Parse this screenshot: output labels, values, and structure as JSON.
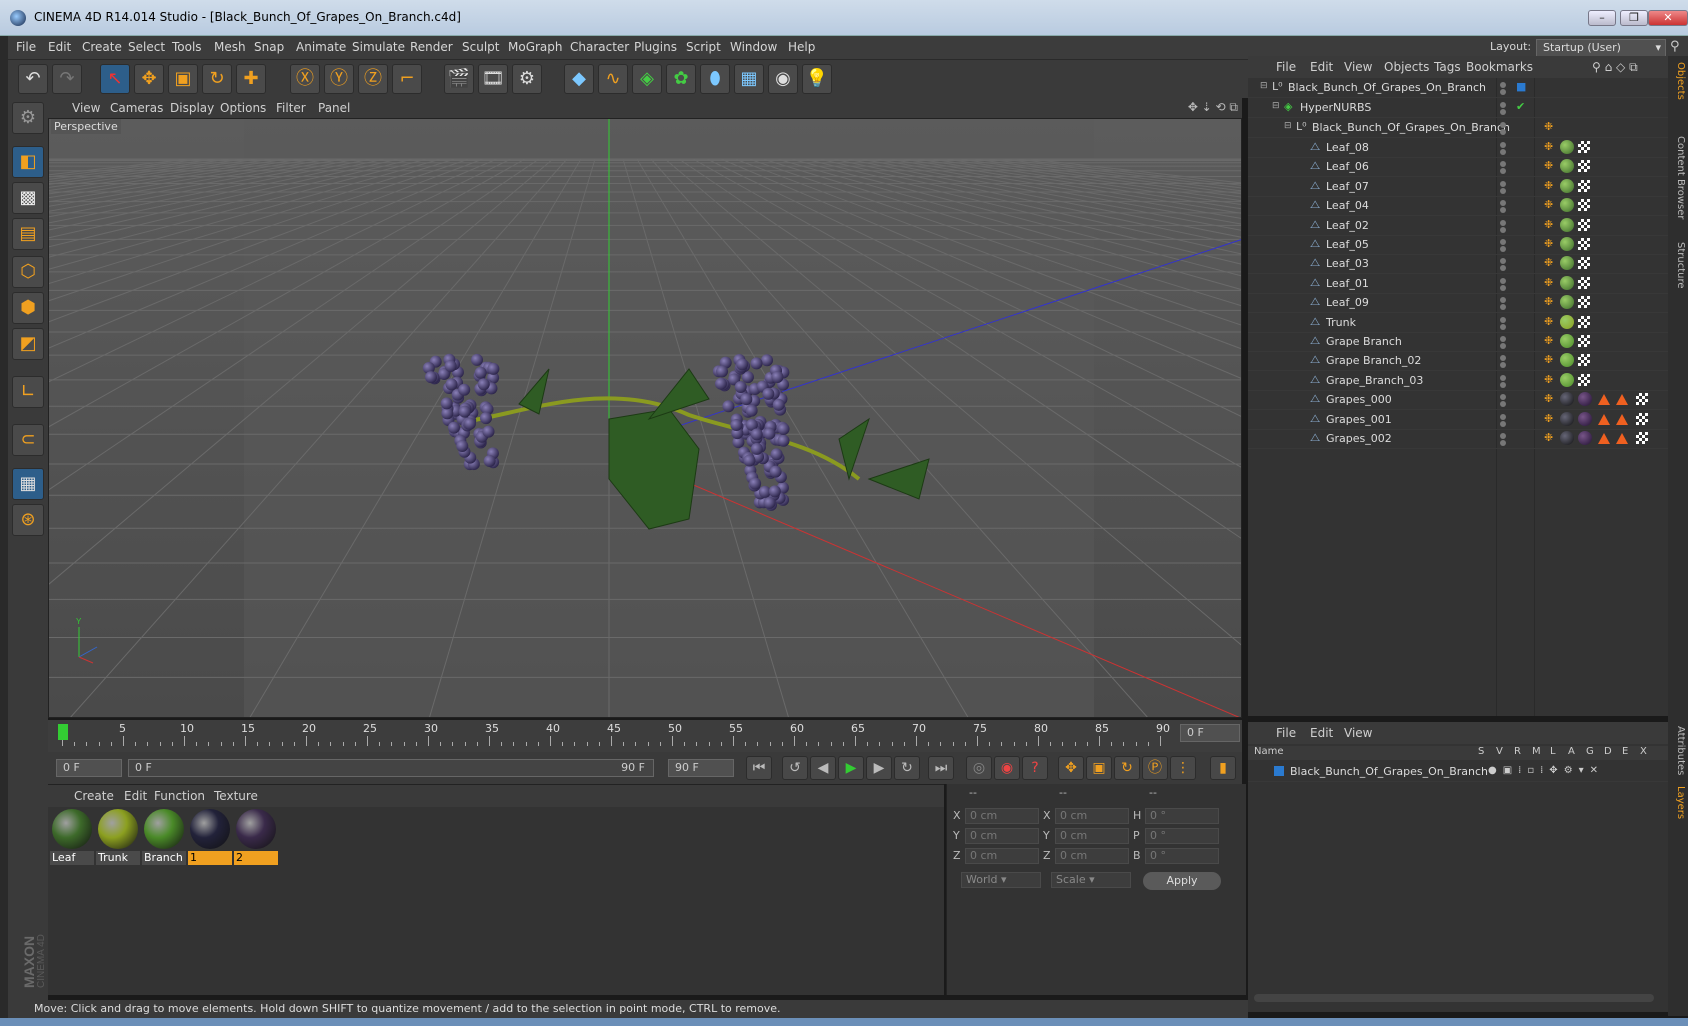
{
  "window": {
    "title": "CINEMA 4D R14.014 Studio - [Black_Bunch_Of_Grapes_On_Branch.c4d]"
  },
  "menubar": {
    "items": [
      "File",
      "Edit",
      "Create",
      "Select",
      "Tools",
      "Mesh",
      "Snap",
      "Animate",
      "Simulate",
      "Render",
      "Sculpt",
      "MoGraph",
      "Character",
      "Plugins",
      "Script",
      "Window",
      "Help"
    ],
    "layout_label": "Layout:",
    "layout_value": "Startup (User)"
  },
  "viewport": {
    "menu": [
      "View",
      "Cameras",
      "Display",
      "Options",
      "Filter",
      "Panel"
    ],
    "label": "Perspective"
  },
  "timeline": {
    "ticks": [
      "0",
      "5",
      "10",
      "15",
      "20",
      "25",
      "30",
      "35",
      "40",
      "45",
      "50",
      "55",
      "60",
      "65",
      "70",
      "75",
      "80",
      "85",
      "90"
    ],
    "current_frame": "0 F",
    "start_field": "0 F",
    "range_start": "0 F",
    "range_end": "90 F",
    "end_field": "90 F"
  },
  "materials": {
    "menu": [
      "Create",
      "Edit",
      "Function",
      "Texture"
    ],
    "items": [
      {
        "label": "Leaf",
        "color": "#3d6a2a",
        "highlight": false
      },
      {
        "label": "Trunk",
        "color": "#8ca020",
        "highlight": false
      },
      {
        "label": "Branch",
        "color": "#4a8a28",
        "highlight": false
      },
      {
        "label": "1",
        "color": "#22223a",
        "highlight": true
      },
      {
        "label": "2",
        "color": "#3a2a4a",
        "highlight": true
      }
    ]
  },
  "coords": {
    "headers": [
      "--",
      "--",
      "--"
    ],
    "rows": [
      {
        "a": "X",
        "av": "0 cm",
        "b": "X",
        "bv": "0 cm",
        "c": "H",
        "cv": "0 °"
      },
      {
        "a": "Y",
        "av": "0 cm",
        "b": "Y",
        "bv": "0 cm",
        "c": "P",
        "cv": "0 °"
      },
      {
        "a": "Z",
        "av": "0 cm",
        "b": "Z",
        "bv": "0 cm",
        "c": "B",
        "cv": "0 °"
      }
    ],
    "mode1": "World",
    "mode2": "Scale",
    "apply": "Apply"
  },
  "objects": {
    "menu": [
      "File",
      "Edit",
      "View",
      "Objects",
      "Tags",
      "Bookmarks"
    ],
    "root": "Black_Bunch_Of_Grapes_On_Branch",
    "hypernurbs": "HyperNURBS",
    "group": "Black_Bunch_Of_Grapes_On_Branch",
    "children": [
      {
        "name": "Leaf_08",
        "tag": "leaf"
      },
      {
        "name": "Leaf_06",
        "tag": "leaf"
      },
      {
        "name": "Leaf_07",
        "tag": "leaf"
      },
      {
        "name": "Leaf_04",
        "tag": "leaf"
      },
      {
        "name": "Leaf_02",
        "tag": "leaf"
      },
      {
        "name": "Leaf_05",
        "tag": "leaf"
      },
      {
        "name": "Leaf_03",
        "tag": "leaf"
      },
      {
        "name": "Leaf_01",
        "tag": "leaf"
      },
      {
        "name": "Leaf_09",
        "tag": "leaf"
      },
      {
        "name": "Trunk",
        "tag": "trunk"
      },
      {
        "name": "Grape Branch",
        "tag": "branch"
      },
      {
        "name": "Grape Branch_02",
        "tag": "branch"
      },
      {
        "name": "Grape_Branch_03",
        "tag": "branch"
      },
      {
        "name": "Grapes_000",
        "tag": "grapes"
      },
      {
        "name": "Grapes_001",
        "tag": "grapes"
      },
      {
        "name": "Grapes_002",
        "tag": "grapes"
      }
    ]
  },
  "layers": {
    "menu": [
      "File",
      "Edit",
      "View"
    ],
    "columns": [
      "Name",
      "S",
      "V",
      "R",
      "M",
      "L",
      "A",
      "G",
      "D",
      "E",
      "X"
    ],
    "row": "Black_Bunch_Of_Grapes_On_Branch"
  },
  "sidetabs": [
    "Objects",
    "Content Browser",
    "Structure",
    "Attributes",
    "Layers"
  ],
  "status": "Move: Click and drag to move elements. Hold down SHIFT to quantize movement / add to the selection in point mode, CTRL to remove.",
  "branding": "MAXON CINEMA 4D"
}
